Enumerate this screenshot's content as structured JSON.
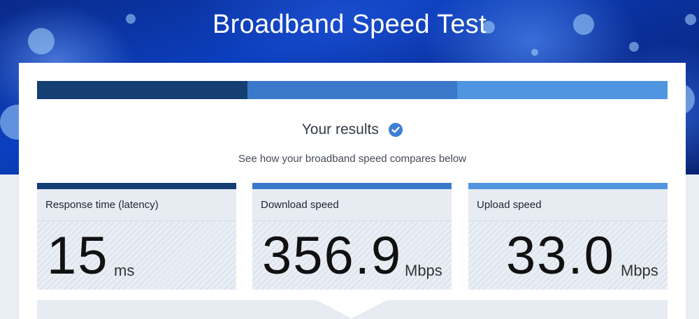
{
  "header": {
    "title": "Broadband Speed Test"
  },
  "progress": {
    "colors": [
      "#153e73",
      "#3a78c9",
      "#4f95e0"
    ]
  },
  "results": {
    "title": "Your results",
    "subtitle": "See how your broadband speed compares below",
    "icon": "check-circle-icon"
  },
  "metrics": [
    {
      "label": "Response time (latency)",
      "value": "15",
      "unit": "ms",
      "color": "#153e73"
    },
    {
      "label": "Download speed",
      "value": "356.9",
      "unit": "Mbps",
      "color": "#3a78c9"
    },
    {
      "label": "Upload speed",
      "value": "33.0",
      "unit": "Mbps",
      "color": "#4f95e0"
    }
  ]
}
